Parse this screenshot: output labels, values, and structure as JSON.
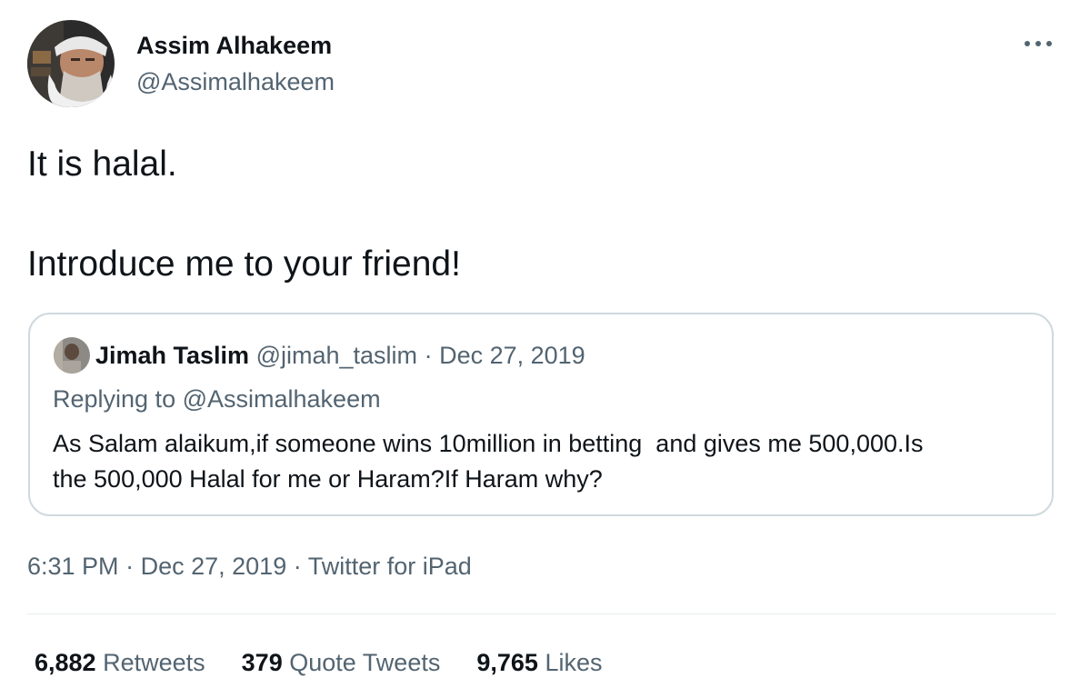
{
  "author": {
    "name": "Assim Alhakeem",
    "handle": "@Assimalhakeem"
  },
  "tweet": {
    "line1": "It is halal.",
    "line2": "Introduce me to your friend!"
  },
  "quoted": {
    "name": "Jimah Taslim",
    "handle": "@jimah_taslim",
    "separator": "·",
    "date": "Dec 27, 2019",
    "replying_prefix": "Replying to ",
    "replying_handle": "@Assimalhakeem",
    "body_line1": "As Salam alaikum,if someone wins 10million in betting  and gives me 500,000.Is",
    "body_line2": "the 500,000 Halal for me or Haram?If Haram why?"
  },
  "meta": {
    "time": "6:31 PM",
    "sep": "·",
    "date": "Dec 27, 2019",
    "source": "Twitter for iPad"
  },
  "stats": {
    "retweets_count": "6,882",
    "retweets_label": "Retweets",
    "quotes_count": "379",
    "quotes_label": "Quote Tweets",
    "likes_count": "9,765",
    "likes_label": "Likes"
  },
  "icons": {
    "more": "more-horizontal-icon"
  },
  "colors": {
    "text": "#0f1419",
    "muted": "#536471",
    "border": "#cfd9de"
  }
}
